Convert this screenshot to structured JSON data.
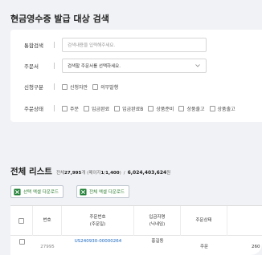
{
  "search": {
    "title": "현금영수증 발급 대상 검색",
    "rows": [
      {
        "label": "통합검색",
        "placeholder": "검색내용을 입력해주세요."
      },
      {
        "label": "주문서",
        "value": "검색할 주문서를 선택하세요."
      },
      {
        "label": "신청구분",
        "options": [
          "신청자만",
          "의무발행"
        ]
      },
      {
        "label": "주문상태",
        "options": [
          "주문",
          "입금완료",
          "입금완료B",
          "상품준비",
          "상품출고",
          "상품출고"
        ]
      }
    ]
  },
  "list": {
    "title": "전체 리스트",
    "count_prefix": "전체",
    "count": "27,995",
    "count_suffix": "개 (페이지",
    "page": "1",
    "page_sep": "/",
    "pages": "1,400",
    "page_close": ")",
    "amount_sep": "/",
    "amount": "6,024,403,624",
    "amount_unit": "원"
  },
  "buttons": {
    "select_excel": "선택 엑셀 다운로드",
    "all_excel": "전체 엑셀 다운로드"
  },
  "table": {
    "headers": {
      "no": "번호",
      "order_no": "주문번호",
      "order_no_sub": "(주문일)",
      "depositor": "입금자명",
      "depositor_sub": "(닉네임)",
      "status": "주문상태"
    },
    "rows": [
      {
        "no": "27995",
        "order_no": "US240930-00000264",
        "depositor": "홍길동",
        "status": "주문",
        "extra": "260"
      }
    ]
  },
  "colors": {
    "accent_link": "#1565c0",
    "excel_green": "#2e7d32"
  }
}
